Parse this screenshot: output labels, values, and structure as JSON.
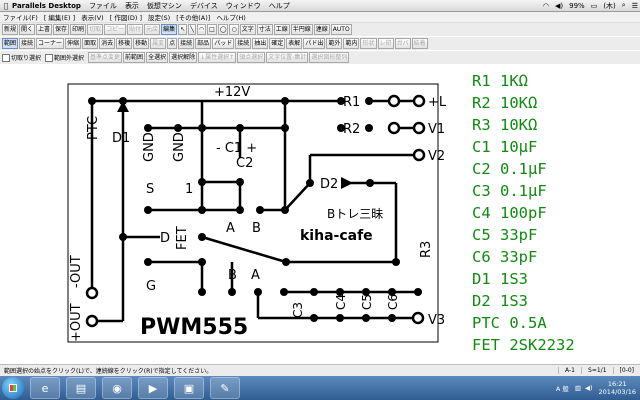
{
  "mac_menubar": {
    "app": "Parallels Desktop",
    "items": [
      "ファイル",
      "表示",
      "仮想マシン",
      "デバイス",
      "ウィンドウ",
      "ヘルプ"
    ],
    "battery": "99%",
    "datetime": "(木)"
  },
  "win_menubar": {
    "items": [
      "ファイル(F)",
      "[ 編集(E) ]",
      "表示(V)",
      "[ 作図(D) ]",
      "設定(S)",
      "[その他(A)]",
      "ヘルプ(H)"
    ]
  },
  "toolbar1": [
    "新規",
    "開く",
    "上書",
    "保存",
    "印刷",
    "切取",
    "コピー",
    "貼付",
    "元戻",
    "編集",
    "文字",
    "寸法",
    "工線",
    "半円線",
    "連線",
    "AUTO"
  ],
  "toolbar2": [
    "範囲",
    "接続",
    "コーナー",
    "伸縮",
    "面取",
    "消去",
    "移複",
    "移動",
    "属変",
    "点",
    "接続",
    "部品",
    "パッド",
    "接続",
    "抽出",
    "確定",
    "表解",
    "パド出",
    "範外",
    "範内",
    "形状",
    "レ印",
    "ガバ",
    "結着"
  ],
  "toolbar3": {
    "check1": "切取り選択",
    "check2": "範囲外選択",
    "buttons": [
      "基準点変更",
      "前範囲",
      "全選択",
      "選択解除",
      "↓属性選択↑",
      "領点選択",
      "文字位置-集計",
      "選択図形整列"
    ]
  },
  "parts_list": [
    "R1 1KΩ",
    "R2 10KΩ",
    "R3 10KΩ",
    "C1 10μF",
    "C2 0.1μF",
    "C3 0.1μF",
    "C4 100pF",
    "C5 33pF",
    "C6 33pF",
    "D1 1S3",
    "D2 1S3",
    "PTC 0.5A",
    "FET 2SK2232"
  ],
  "pcb_labels": {
    "v12": "+12V",
    "r1": "R1",
    "r2": "R2",
    "plus_l": "+L",
    "v1": "V1",
    "v2": "V2",
    "v3": "V3",
    "ptc": "PTC",
    "d1": "D1",
    "gnd1": "GND",
    "gnd2": "GND",
    "c1": "- C1 +",
    "c2": "C2",
    "s": "S",
    "one": "1",
    "d2": "D2",
    "brand_jp": "Bトレ三昧",
    "brand": "kiha-cafe",
    "d": "D",
    "fet": "FET",
    "a1": "A",
    "b1": "B",
    "r3": "R3",
    "g": "G",
    "a2": "A",
    "b2": "B",
    "c3": "C3",
    "c4": "C4",
    "c5": "C5",
    "c6": "C6",
    "out_minus": "-OUT",
    "out_plus": "+OUT",
    "title": "PWM555"
  },
  "statusbar": {
    "message": "範囲選択の始点をクリック(L)で、連続線をクリック(R)で指定してください。",
    "cell1": "A-1",
    "cell2": "S=1/1",
    "cell3": "[0-0]"
  },
  "tray": {
    "time": "16:21",
    "date": "2014/03/16"
  },
  "colors": {
    "parts_text": "#128a12",
    "pcb_trace": "#000000"
  }
}
